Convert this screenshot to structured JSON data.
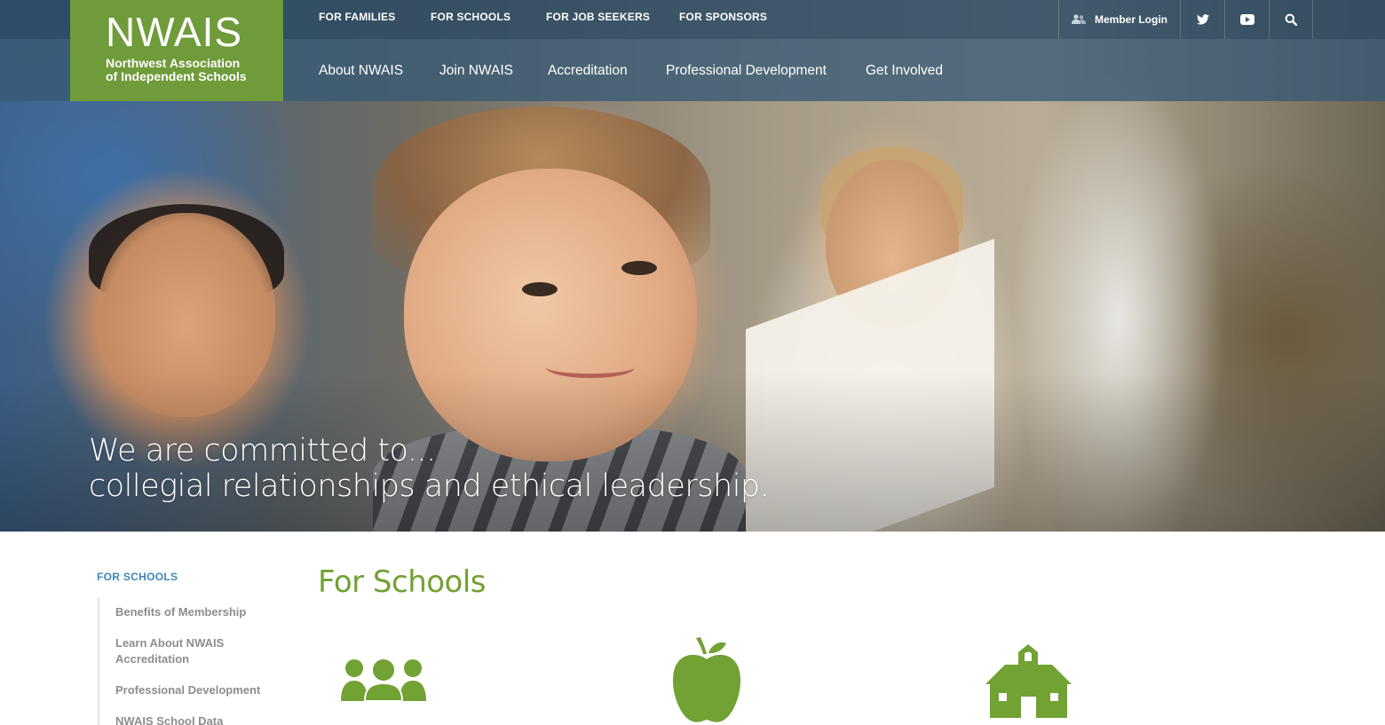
{
  "brand": {
    "logo_mark": "NWAIS",
    "name_line1": "Northwest Association",
    "name_line2": "of Independent Schools",
    "accent": "#6f9b3a"
  },
  "utility_nav": {
    "items": [
      {
        "label": "FOR FAMILIES"
      },
      {
        "label": "FOR SCHOOLS"
      },
      {
        "label": "FOR JOB SEEKERS"
      },
      {
        "label": "FOR SPONSORS"
      }
    ]
  },
  "tools": {
    "member_login": "Member Login",
    "icons": [
      "user-icon",
      "twitter-icon",
      "youtube-icon",
      "search-icon"
    ]
  },
  "main_nav": {
    "items": [
      {
        "label": "About NWAIS"
      },
      {
        "label": "Join NWAIS"
      },
      {
        "label": "Accreditation"
      },
      {
        "label": "Professional Development"
      },
      {
        "label": "Get Involved"
      }
    ]
  },
  "hero": {
    "line1": "We are committed to...",
    "line2": "collegial relationships and ethical leadership."
  },
  "sidebar": {
    "heading": "FOR SCHOOLS",
    "items": [
      {
        "label": "Benefits of Membership"
      },
      {
        "label": "Learn About NWAIS Accreditation"
      },
      {
        "label": "Professional Development"
      },
      {
        "label": "NWAIS School Data"
      }
    ]
  },
  "main": {
    "title": "For Schools",
    "feature_icons": [
      "people-group-icon",
      "apple-icon",
      "schoolhouse-icon"
    ],
    "icon_color": "#72a134"
  }
}
